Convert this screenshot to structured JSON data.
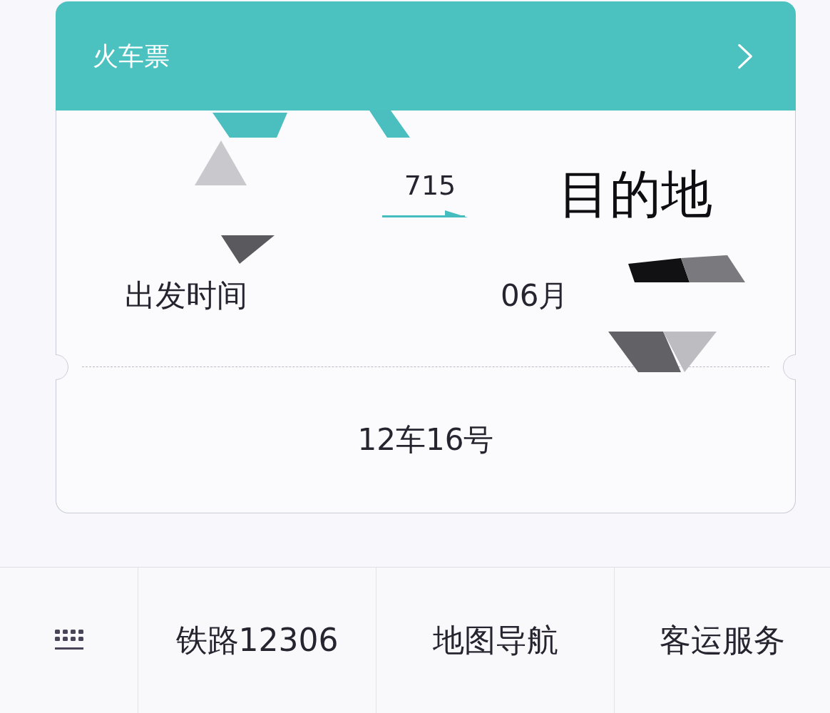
{
  "card": {
    "title": "火车票",
    "train_number": "715",
    "destination": "目的地",
    "departure_label": "出发时间",
    "departure_date": "06月",
    "seat": "12车16号"
  },
  "bottom_bar": {
    "items": [
      {
        "kind": "keyboard"
      },
      {
        "kind": "link",
        "label": "铁路12306"
      },
      {
        "kind": "link",
        "label": "地图导航"
      },
      {
        "kind": "link",
        "label": "客运服务"
      }
    ]
  }
}
